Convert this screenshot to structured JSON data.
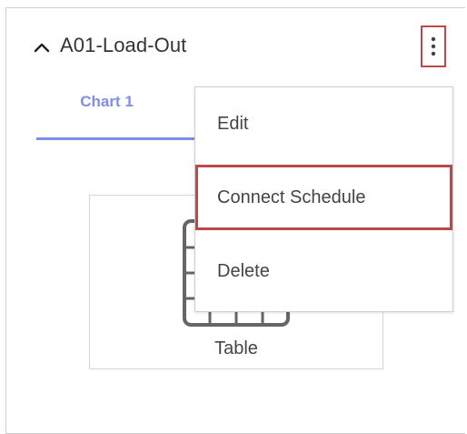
{
  "panel": {
    "title": "A01-Load-Out",
    "collapse_icon": "chevron-up-icon",
    "menu_icon": "kebab-vertical-icon"
  },
  "tabs": [
    {
      "label": "Chart 1",
      "active": true
    }
  ],
  "widget": {
    "icon": "table-icon",
    "label": "Table"
  },
  "context_menu": {
    "items": [
      {
        "label": "Edit"
      },
      {
        "label": "Connect Schedule",
        "highlighted": true
      },
      {
        "label": "Delete"
      }
    ]
  },
  "colors": {
    "accent": "#7d8ee8",
    "highlight_border": "#b94a4a",
    "text": "#333333",
    "icon_gray": "#666666"
  }
}
